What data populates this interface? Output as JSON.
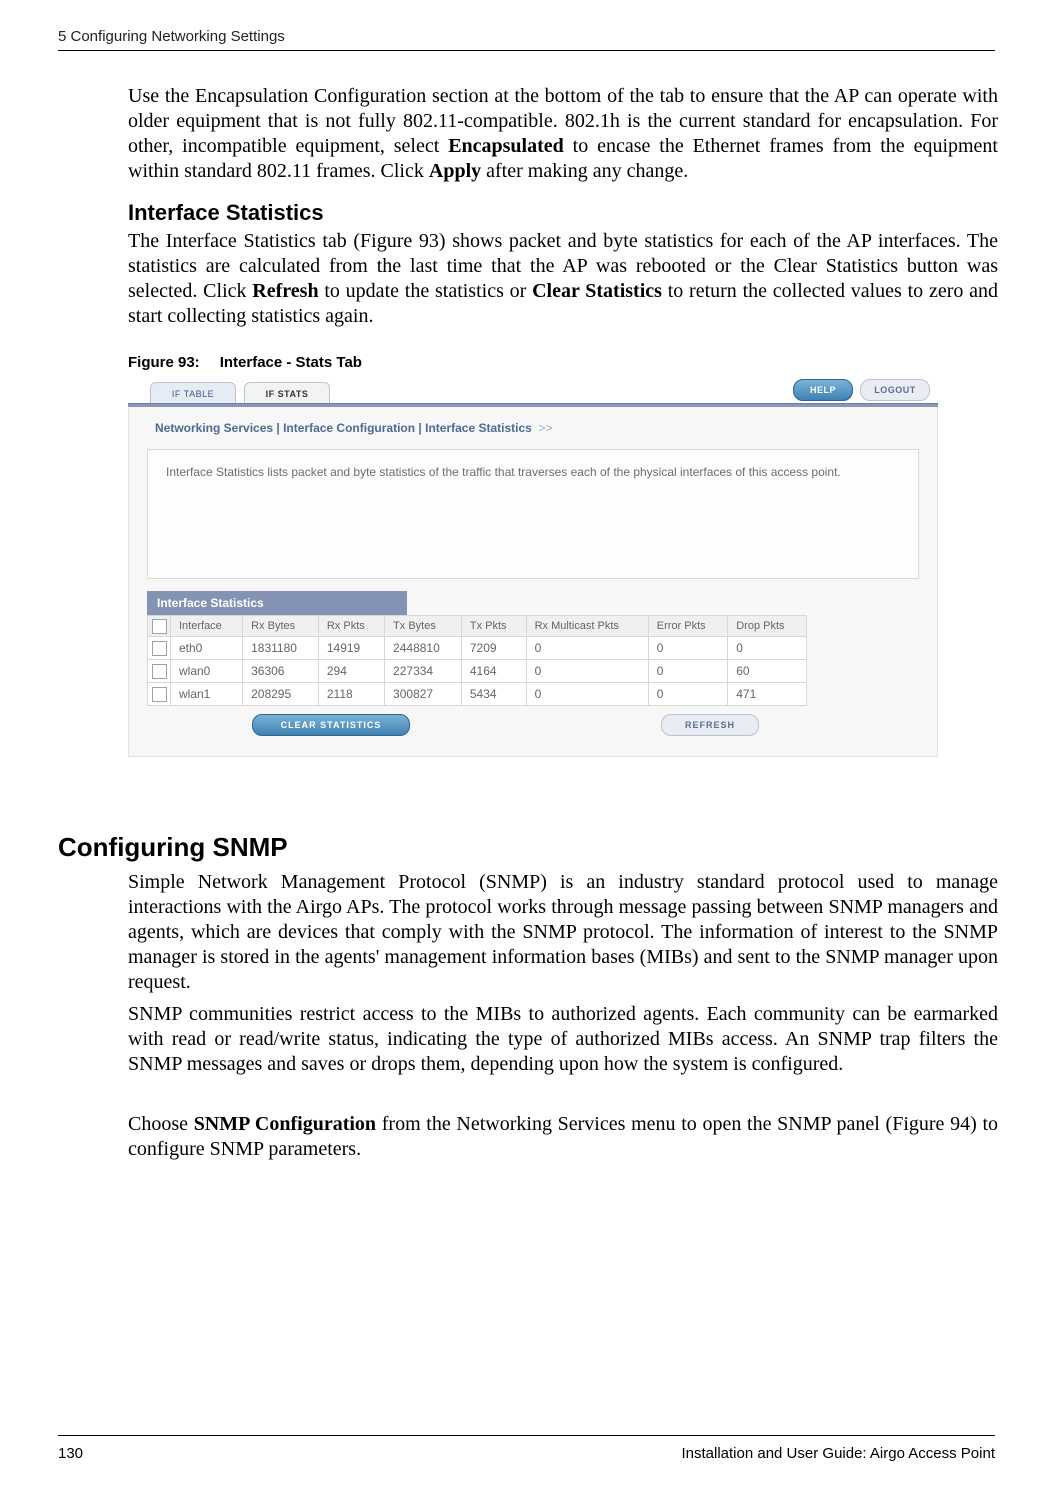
{
  "header": {
    "chapter": "5  Configuring Networking Settings"
  },
  "paragraphs": {
    "p1": "Use the Encapsulation Configuration section at the bottom of the tab to ensure that the AP can operate with older equipment that is not fully 802.11-compatible. 802.1h is the current standard for encapsulation. For other, incompatible equipment, select ",
    "p1b": "Encapsulated",
    "p1c": " to encase the Ethernet frames from the equipment within standard 802.11 frames. Click ",
    "p1d": "Apply",
    "p1e": " after making any change.",
    "h2a": "Interface Statistics",
    "p2": "The Interface Statistics tab (Figure 93) shows packet and byte statistics for each of the AP interfaces. The statistics are calculated from the last time that the AP was rebooted or the Clear Statistics button was selected. Click ",
    "p2b": "Refresh",
    "p2c": " to update the statistics or ",
    "p2d": "Clear Statistics",
    "p2e": " to return the collected values to zero and start collecting statistics again.",
    "figcap_no": "Figure 93:",
    "figcap_title": "Interface - Stats Tab",
    "h1": "Configuring SNMP",
    "p3": "Simple Network Management Protocol (SNMP) is an industry standard protocol used to manage interactions with the Airgo APs. The protocol works through message passing between SNMP managers and agents, which are devices that comply with the SNMP protocol. The information of interest to the SNMP manager is stored in the agents' management information bases (MIBs) and sent to the SNMP manager upon request.",
    "p4": "SNMP communities restrict access to the MIBs to authorized agents. Each community can be earmarked with read or read/write status, indicating the type of authorized MIBs access. An SNMP trap filters the SNMP messages and saves or drops them, depending upon how the system is configured.",
    "p5a": "Choose ",
    "p5b": "SNMP Configuration",
    "p5c": " from the Networking Services menu to open the SNMP panel (Figure 94) to configure SNMP parameters."
  },
  "figure": {
    "tabs": {
      "inactive": "IF TABLE",
      "active": "IF STATS"
    },
    "buttons": {
      "help": "HELP",
      "logout": "LOGOUT",
      "clear": "CLEAR STATISTICS",
      "refresh": "REFRESH"
    },
    "breadcrumb": "Networking Services | Interface Configuration | Interface Statistics",
    "breadcrumb_suffix": ">>",
    "intro": "Interface Statistics lists packet and byte statistics of the traffic that traverses each of the physical interfaces of this access point.",
    "section_title": "Interface Statistics",
    "columns": [
      "Interface",
      "Rx Bytes",
      "Rx Pkts",
      "Tx Bytes",
      "Tx Pkts",
      "Rx Multicast Pkts",
      "Error Pkts",
      "Drop Pkts"
    ],
    "rows": [
      {
        "iface": "eth0",
        "rxb": "1831180",
        "rxp": "14919",
        "txb": "2448810",
        "txp": "7209",
        "rxm": "0",
        "err": "0",
        "drop": "0"
      },
      {
        "iface": "wlan0",
        "rxb": "36306",
        "rxp": "294",
        "txb": "227334",
        "txp": "4164",
        "rxm": "0",
        "err": "0",
        "drop": "60"
      },
      {
        "iface": "wlan1",
        "rxb": "208295",
        "rxp": "2118",
        "txb": "300827",
        "txp": "5434",
        "rxm": "0",
        "err": "0",
        "drop": "471"
      }
    ]
  },
  "footer": {
    "page": "130",
    "title": "Installation and User Guide: Airgo Access Point"
  }
}
